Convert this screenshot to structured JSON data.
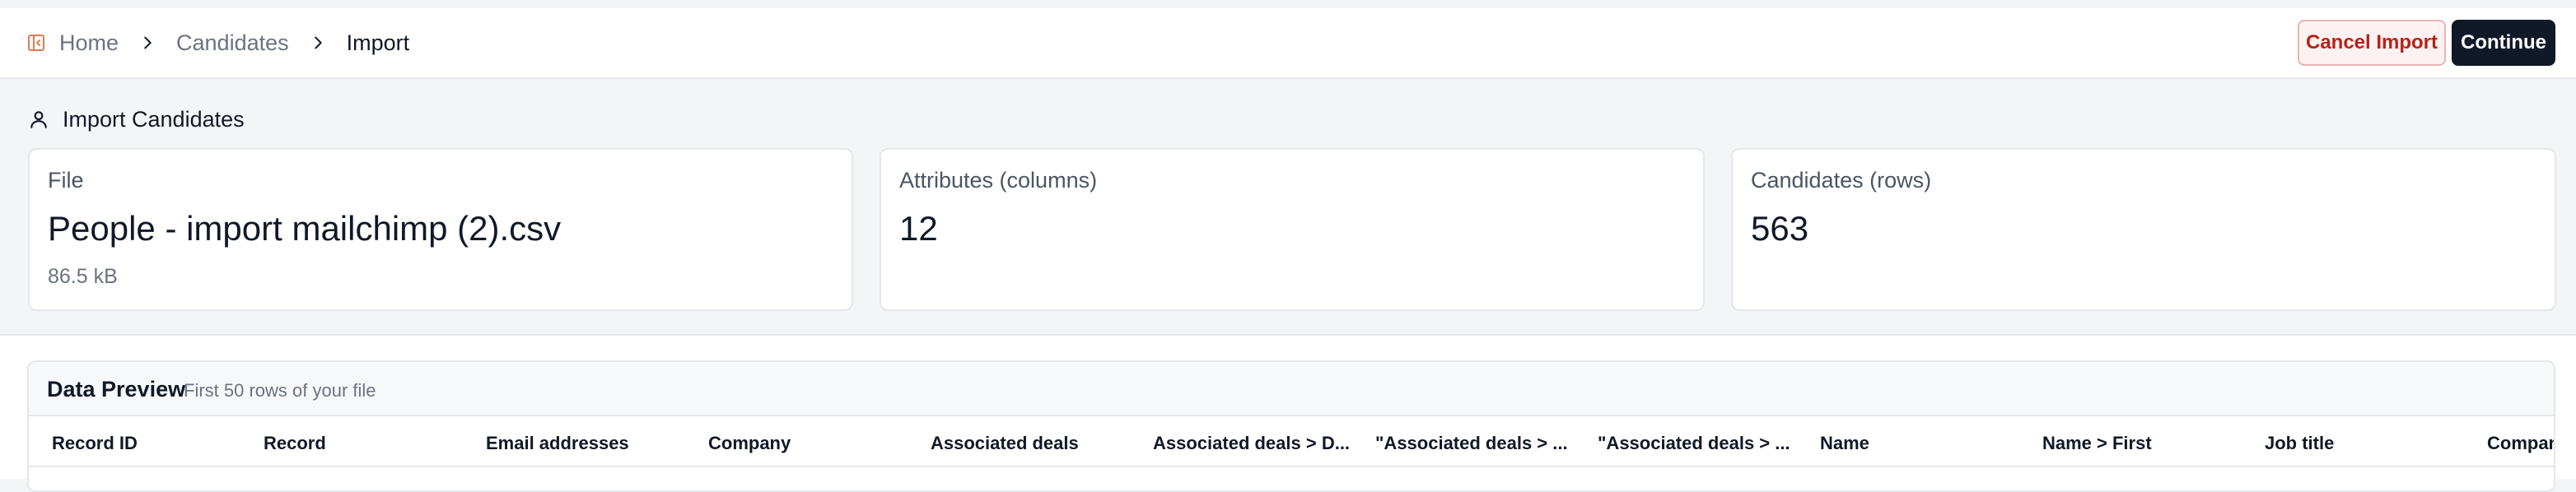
{
  "header": {
    "breadcrumb": [
      "Home",
      "Candidates",
      "Import"
    ],
    "cancel_label": "Cancel Import",
    "continue_label": "Continue"
  },
  "section": {
    "title": "Import Candidates"
  },
  "cards": [
    {
      "label": "File",
      "value": "People - import mailchimp (2).csv",
      "sub": "86.5 kB"
    },
    {
      "label": "Attributes (columns)",
      "value": "12"
    },
    {
      "label": "Candidates (rows)",
      "value": "563"
    }
  ],
  "preview": {
    "title": "Data Preview",
    "subtitle": "First 50 rows of your file",
    "columns": [
      "Record ID",
      "Record",
      "Email addresses",
      "Company",
      "Associated deals",
      "Associated deals > D...",
      "\"Associated deals > ...",
      "\"Associated deals > ...",
      "Name",
      "Name > First",
      "Job title",
      "Compan"
    ]
  },
  "colors": {
    "accent_icon": "#e07b53",
    "cancel_bg": "#fdf2f2",
    "cancel_text": "#b42318",
    "continue_bg": "#111827"
  },
  "icons": {
    "sidebar": "sidebar-toggle-icon",
    "breadcrumb_sep": "chevron-right-icon",
    "section": "user-icon"
  }
}
